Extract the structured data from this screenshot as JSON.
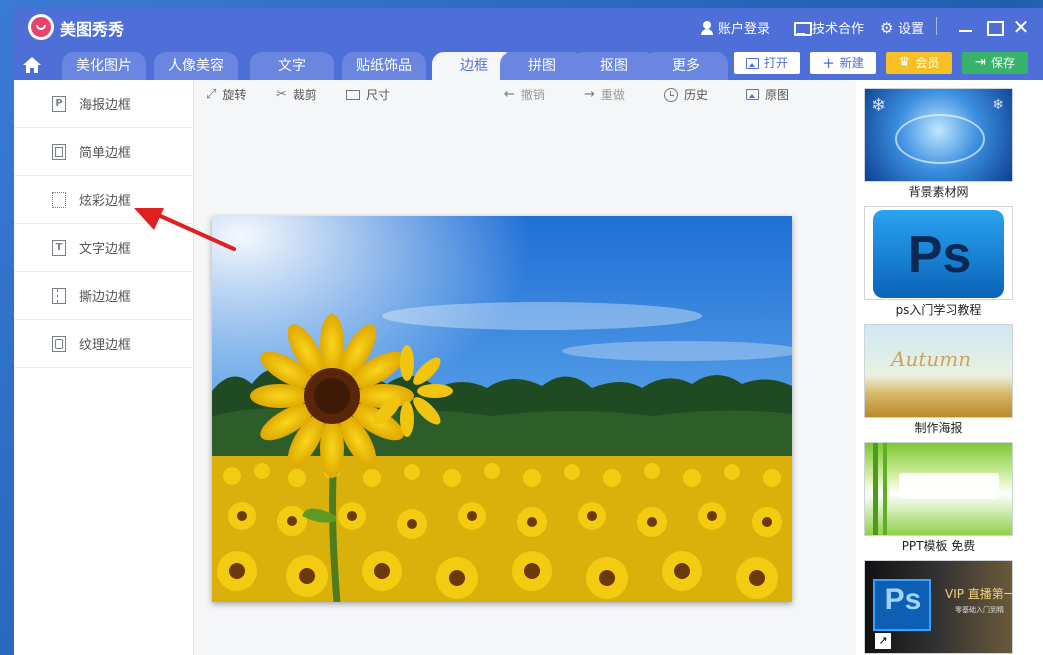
{
  "app": {
    "title": "美图秀秀"
  },
  "titlebar": {
    "login_label": "账户登录",
    "cooperation_label": "技术合作",
    "settings_label": "设置"
  },
  "tabs": [
    {
      "label": "美化图片",
      "active": false
    },
    {
      "label": "人像美容",
      "active": false
    },
    {
      "label": "文字",
      "active": false
    },
    {
      "label": "贴纸饰品",
      "active": false
    },
    {
      "label": "边框",
      "active": true
    },
    {
      "label": "拼图",
      "active": false
    },
    {
      "label": "抠图",
      "active": false
    },
    {
      "label": "更多",
      "active": false
    }
  ],
  "header_buttons": {
    "open": "打开",
    "new": "新建",
    "vip": "会员",
    "save": "保存"
  },
  "sidebar": {
    "items": [
      {
        "label": "海报边框",
        "icon": "poster-frame-icon",
        "glyph": "P"
      },
      {
        "label": "简单边框",
        "icon": "simple-frame-icon",
        "glyph": ""
      },
      {
        "label": "炫彩边框",
        "icon": "colorful-frame-icon",
        "glyph": ""
      },
      {
        "label": "文字边框",
        "icon": "text-frame-icon",
        "glyph": "T"
      },
      {
        "label": "撕边边框",
        "icon": "torn-frame-icon",
        "glyph": ""
      },
      {
        "label": "纹理边框",
        "icon": "texture-frame-icon",
        "glyph": ""
      }
    ]
  },
  "toolbar": {
    "rotate": "旋转",
    "crop": "裁剪",
    "size": "尺寸",
    "undo": "撤销",
    "redo": "重做",
    "history": "历史",
    "original": "原图"
  },
  "ads": [
    {
      "caption": "背景素材网"
    },
    {
      "caption": "ps入门学习教程",
      "thumb_text": "Ps"
    },
    {
      "caption": "制作海报",
      "thumb_text": "Autumn"
    },
    {
      "caption": "PPT模板 免费"
    },
    {
      "caption": "",
      "thumb_text": "Ps",
      "banner_text": "VIP 直播第一",
      "banner_sub": "零基础入门到精"
    }
  ],
  "colors": {
    "brand": "#4f6fd8",
    "vip": "#f6c026",
    "save": "#37b36b",
    "annotation": "#e02020"
  }
}
